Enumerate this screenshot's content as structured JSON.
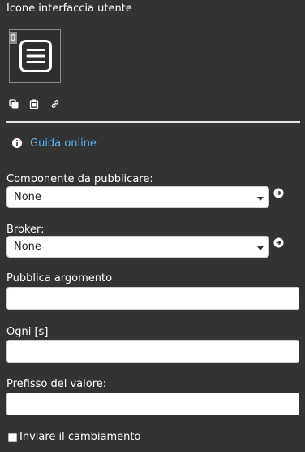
{
  "section": {
    "title": "Icone interfaccia utente"
  },
  "icon_slot": {
    "index": "0",
    "icon": "menu-lines-icon"
  },
  "toolbar": {
    "icons": [
      "copy-icon",
      "paste-icon",
      "link-icon"
    ]
  },
  "help": {
    "icon": "info-icon",
    "label": "Guida online",
    "color": "#5cb3f0"
  },
  "component": {
    "label": "Componente da pubblicare:",
    "value": "None",
    "action_icon": "arrow-right-circle-icon"
  },
  "broker": {
    "label": "Broker:",
    "value": "None",
    "action_icon": "arrow-right-circle-icon"
  },
  "topic": {
    "label": "Pubblica argomento",
    "value": ""
  },
  "interval": {
    "label": "Ogni [s]",
    "value": ""
  },
  "prefix": {
    "label": "Prefisso del valore:",
    "value": ""
  },
  "send_change": {
    "label": "Inviare il cambiamento",
    "checked": false
  },
  "colors": {
    "background": "#333333",
    "divider": "#e6e6e6",
    "link": "#5cb3f0"
  }
}
